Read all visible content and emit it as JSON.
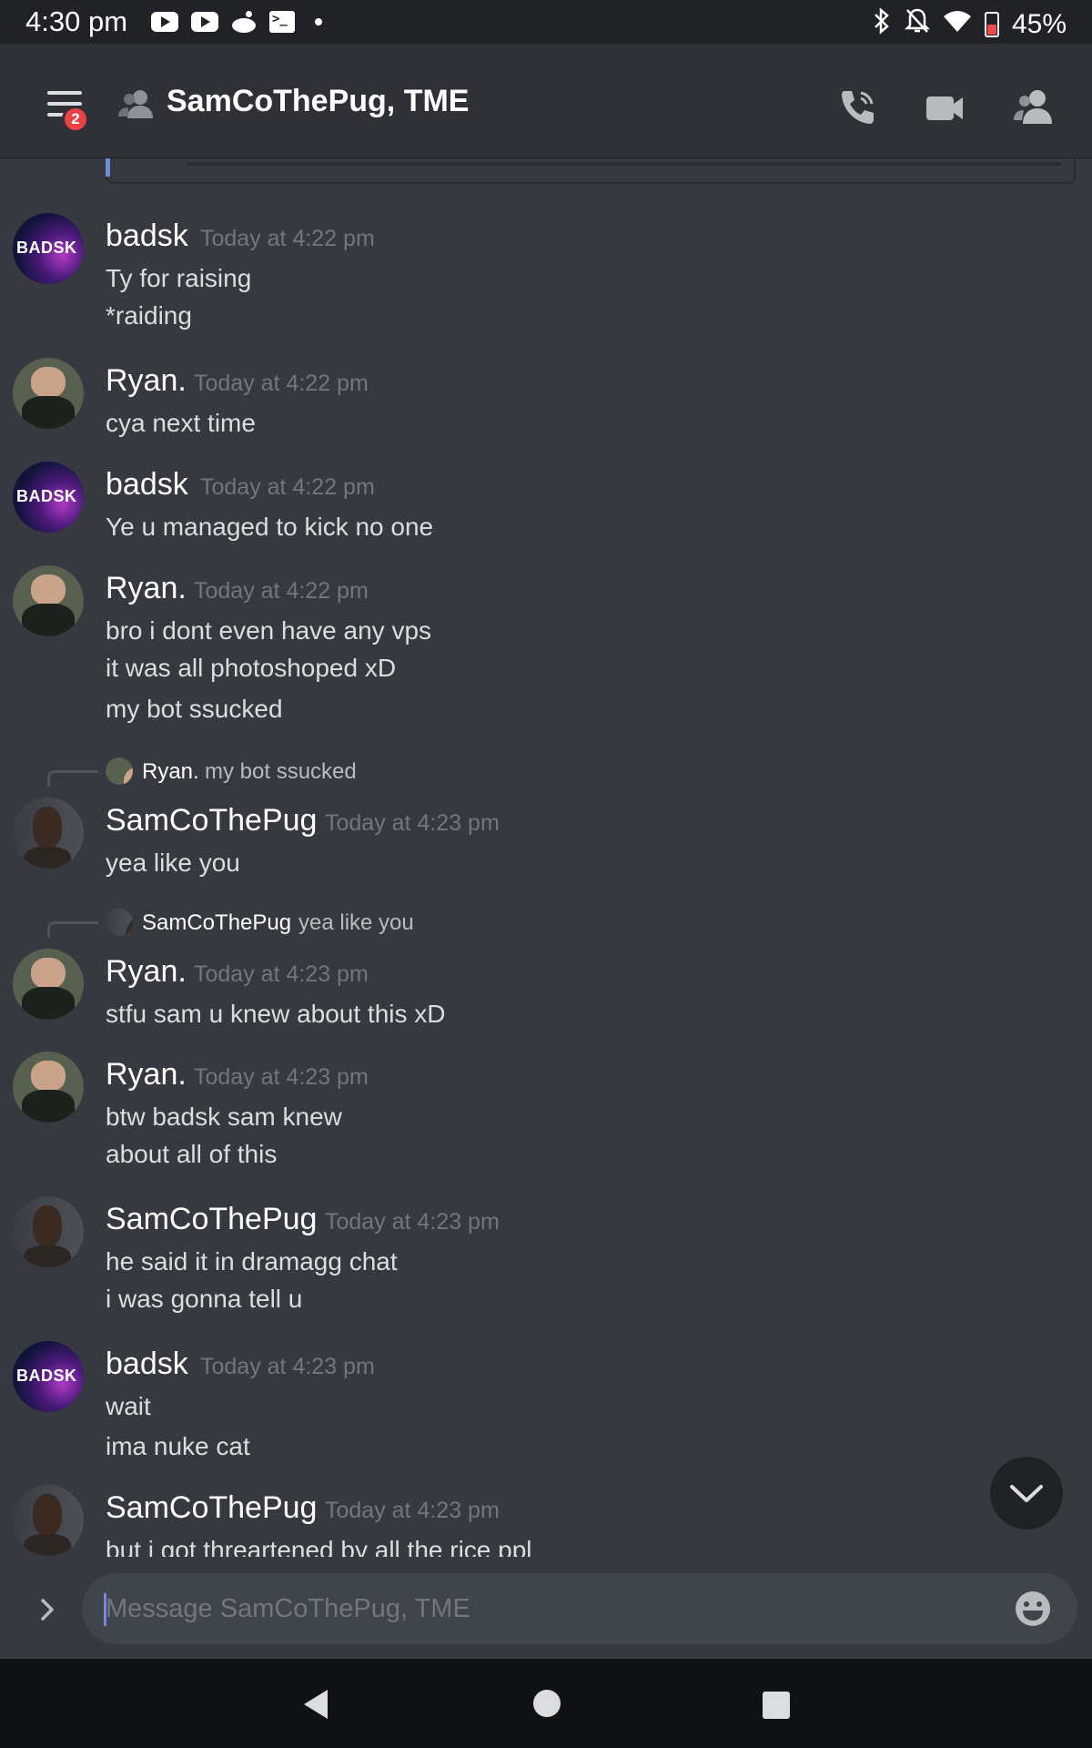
{
  "status_bar": {
    "time": "4:30 pm",
    "battery_percent": "45%",
    "left_icons": [
      "youtube-icon",
      "youtube-icon",
      "reddit-icon",
      "terminal-icon",
      "dot-icon"
    ],
    "right_icons": [
      "bluetooth-icon",
      "notifications-off-icon",
      "wifi-icon",
      "battery-icon"
    ]
  },
  "header": {
    "title": "SamCoThePug, TME",
    "badge_count": "2",
    "actions": [
      "call-icon",
      "video-icon",
      "members-icon"
    ]
  },
  "messages": [
    {
      "author": "badsk",
      "timestamp": "Today at 4:22 pm",
      "avatar": "badsk",
      "avatar_text": "BADSK",
      "lines": [
        "Ty for raising",
        "*raiding"
      ]
    },
    {
      "author": "Ryan.",
      "timestamp": "Today at 4:22 pm",
      "avatar": "ryan",
      "lines": [
        "cya next time"
      ]
    },
    {
      "author": "badsk",
      "timestamp": "Today at 4:22 pm",
      "avatar": "badsk",
      "avatar_text": "BADSK",
      "lines": [
        "Ye u managed to kick no one"
      ]
    },
    {
      "author": "Ryan.",
      "timestamp": "Today at 4:22 pm",
      "avatar": "ryan",
      "lines": [
        "bro i dont even have any vps",
        "it was all photoshoped xD",
        "my bot ssucked"
      ]
    },
    {
      "author": "SamCoThePug",
      "timestamp": "Today at 4:23 pm",
      "avatar": "sam",
      "reply": {
        "author": "Ryan.",
        "text": "my bot ssucked"
      },
      "lines": [
        "yea like you"
      ]
    },
    {
      "author": "Ryan.",
      "timestamp": "Today at 4:23 pm",
      "avatar": "ryan",
      "reply": {
        "author": "SamCoThePug",
        "text": "yea like you"
      },
      "lines": [
        "stfu sam u knew about this xD"
      ]
    },
    {
      "author": "Ryan.",
      "timestamp": "Today at 4:23 pm",
      "avatar": "ryan",
      "lines": [
        "btw  badsk sam knew",
        "about all of this"
      ]
    },
    {
      "author": "SamCoThePug",
      "timestamp": "Today at 4:23 pm",
      "avatar": "sam",
      "lines": [
        "he said it in dramagg chat",
        "i was gonna tell u"
      ]
    },
    {
      "author": "badsk",
      "timestamp": "Today at 4:23 pm",
      "avatar": "badsk",
      "avatar_text": "BADSK",
      "lines": [
        "wait",
        "ima nuke cat"
      ]
    },
    {
      "author": "SamCoThePug",
      "timestamp": "Today at 4:23 pm",
      "avatar": "sam",
      "lines": [
        "but i got threartened by all the rice ppl"
      ]
    }
  ],
  "input": {
    "placeholder": "Message SamCoThePug, TME"
  },
  "colors": {
    "background": "#36393f",
    "header": "#2f3136",
    "badge": "#ed4245",
    "accent": "#7289da",
    "timestamp": "#72767d"
  }
}
